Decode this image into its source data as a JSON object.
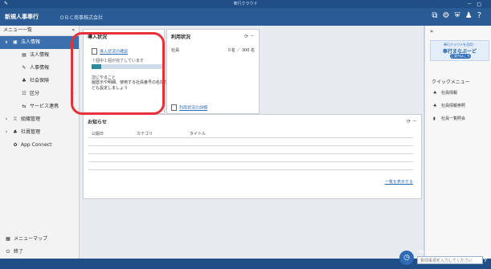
{
  "window": {
    "title": "奉行クラウド",
    "controls": [
      "－",
      "□"
    ]
  },
  "header": {
    "logo": "新規人事奉行",
    "company": "ＯＢＣ商事株式会社",
    "icons": [
      "open-icon",
      "gear-icon",
      "help-icon",
      "user-icon",
      "question-icon"
    ]
  },
  "sidebar": {
    "title": "メニュー一覧",
    "collapse": "«",
    "items": [
      {
        "label": "法人情報",
        "icon": "building",
        "arrow": "∨",
        "active": true
      },
      {
        "label": "法人情報",
        "icon": "doc"
      },
      {
        "label": "人事情報",
        "icon": "pen"
      },
      {
        "label": "社会保険",
        "icon": "people"
      },
      {
        "label": "区分",
        "icon": "list",
        "arrow": "›"
      },
      {
        "label": "サービス連携",
        "icon": "link",
        "arrow": "›"
      },
      {
        "label": "組織管理",
        "icon": "org"
      },
      {
        "label": "社員管理",
        "icon": "people"
      },
      {
        "label": "App Connect",
        "icon": "app"
      }
    ],
    "bottom": [
      {
        "label": "メニューマップ",
        "icon": "map"
      },
      {
        "label": "終了",
        "icon": "power"
      }
    ]
  },
  "intro_panel": {
    "title": "導入状況",
    "link": "導入状況の確認",
    "progress_text": "７個中１個が完了しています",
    "progress": 0.14,
    "todo_title": "次にやること",
    "todo_text": "履歴示や明細、使用する社員番号の名前なども設定しましょう"
  },
  "usage_panel": {
    "title": "利用状況",
    "row_label": "社員",
    "row_value": "０名 ／ 300 名",
    "link": "利用状況の詳細",
    "ctrl": "⟳ －"
  },
  "notice_panel": {
    "title": "お知らせ",
    "columns": [
      "公開日",
      "カテゴリ",
      "タイトル"
    ],
    "more": "一覧を表示する",
    "ctrl": "⟳ －"
  },
  "right_panel": {
    "collapse": "»",
    "promo_small": "奉行クラウドを活用！",
    "promo_brand": "奉行まなぶーど",
    "promo_btn": "ご案内はこちら",
    "quick_title": "クイックメニュー",
    "quick_items": [
      "社員情報",
      "社員情報参照",
      "社員一覧照会"
    ]
  },
  "search": {
    "hint": "奉行クラウド Bot",
    "placeholder": "質問事項を入力してください"
  }
}
